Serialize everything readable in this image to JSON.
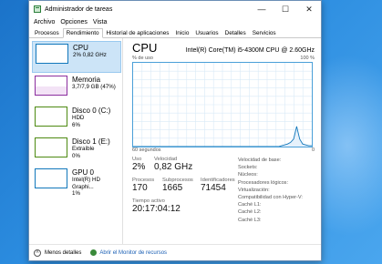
{
  "window": {
    "title": "Administrador de tareas"
  },
  "controls": {
    "minimize": "—",
    "maximize": "☐",
    "close": "✕"
  },
  "menu": [
    "Archivo",
    "Opciones",
    "Vista"
  ],
  "tabs": [
    "Procesos",
    "Rendimiento",
    "Historial de aplicaciones",
    "Inicio",
    "Usuarios",
    "Detalles",
    "Servicios"
  ],
  "sidebar": {
    "items": [
      {
        "name": "CPU",
        "line1": "2% 0,82 GHz",
        "line2": "",
        "color": "#1177bb"
      },
      {
        "name": "Memoria",
        "line1": "3,7/7,9 GB (47%)",
        "line2": "",
        "color": "#8b2e9e"
      },
      {
        "name": "Disco 0 (C:)",
        "line1": "HDD",
        "line2": "6%",
        "color": "#4d8a11"
      },
      {
        "name": "Disco 1 (E:)",
        "line1": "Extraíble",
        "line2": "0%",
        "color": "#4d8a11"
      },
      {
        "name": "GPU 0",
        "line1": "Intel(R) HD Graphi...",
        "line2": "1%",
        "color": "#1177bb"
      }
    ]
  },
  "main": {
    "title": "CPU",
    "model": "Intel(R) Core(TM) i5-4300M CPU @ 2.60GHz",
    "graph_top_left": "% de uso",
    "graph_top_right": "100 %",
    "graph_bottom_left": "60 segundos",
    "graph_bottom_right": "0",
    "usage_trace": [
      0,
      0,
      0,
      0,
      0,
      0,
      0,
      0,
      0,
      0,
      0,
      0,
      0,
      0,
      0,
      0,
      0,
      0,
      0,
      0,
      0,
      0,
      0,
      0,
      0,
      0,
      0,
      0,
      0,
      0,
      0,
      0,
      0,
      0,
      0,
      0,
      0,
      0,
      0,
      0,
      0,
      0,
      0,
      0,
      0,
      0,
      0,
      0,
      0,
      1,
      2,
      3,
      5,
      9,
      24,
      9,
      3,
      2,
      1,
      1
    ]
  },
  "stats": {
    "uso_label": "Uso",
    "uso": "2%",
    "velocidad_label": "Velocidad",
    "velocidad": "0,82 GHz",
    "procesos_label": "Procesos",
    "procesos": "170",
    "subprocesos_label": "Subprocesos",
    "subprocesos": "1665",
    "identificadores_label": "Identificadores",
    "identificadores": "71454",
    "tiempo_label": "Tiempo activo",
    "tiempo": "20:17:04:12"
  },
  "details": [
    "Velocidad de base:",
    "Sockets:",
    "Núcleos:",
    "Procesadores lógicos:",
    "Virtualización:",
    "Compatibilidad con Hyper-V:",
    "Caché L1:",
    "Caché L2:",
    "Caché L3:"
  ],
  "footer": {
    "less_details": "Menos detalles",
    "monitor": "Abrir el Monitor de recursos"
  }
}
